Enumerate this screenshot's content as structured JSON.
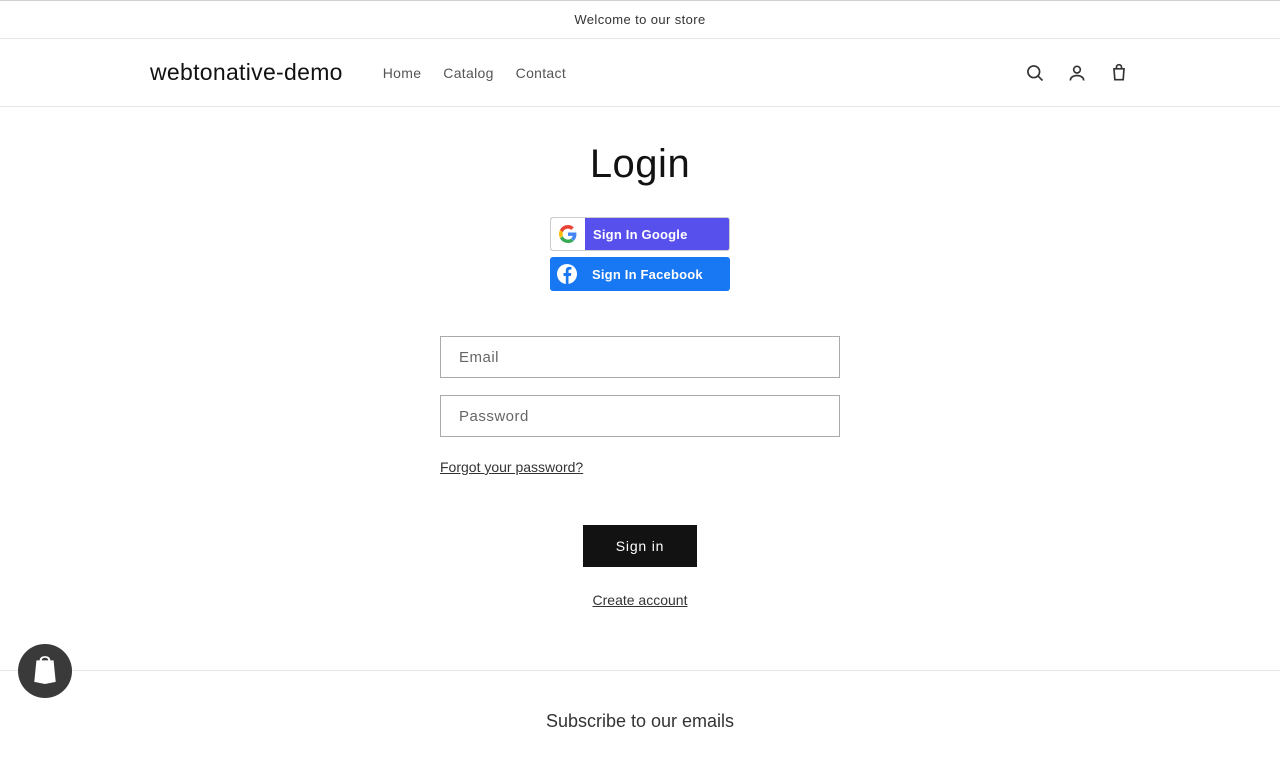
{
  "announcement": "Welcome to our store",
  "header": {
    "logo": "webtonative-demo",
    "nav": {
      "home": "Home",
      "catalog": "Catalog",
      "contact": "Contact"
    }
  },
  "login": {
    "title": "Login",
    "google_label": "Sign In Google",
    "facebook_label": "Sign In Facebook",
    "email_placeholder": "Email",
    "password_placeholder": "Password",
    "forgot_label": "Forgot your password?",
    "signin_label": "Sign in",
    "create_label": "Create account"
  },
  "footer": {
    "subscribe_title": "Subscribe to our emails"
  }
}
